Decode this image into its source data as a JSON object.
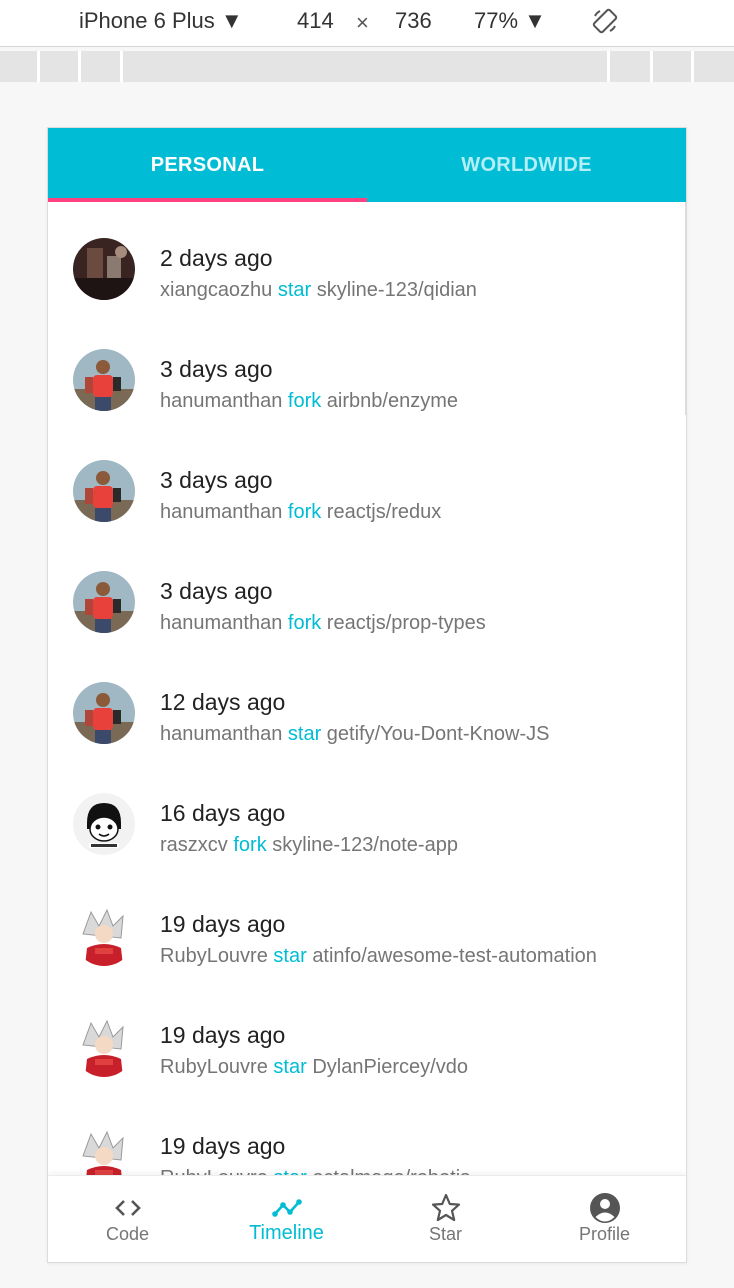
{
  "devtools": {
    "device": "iPhone 6 Plus ▼",
    "width": "414",
    "times": "×",
    "height": "736",
    "zoom": "77% ▼"
  },
  "tabs": [
    {
      "label": "PERSONAL",
      "active": true
    },
    {
      "label": "WORLDWIDE",
      "active": false
    }
  ],
  "feed": [
    {
      "time": "2 days ago",
      "user": "xiangcaozhu",
      "action": "star",
      "repo": "skyline-123/qidian",
      "avatar": "dark-photo"
    },
    {
      "time": "3 days ago",
      "user": "hanumanthan",
      "action": "fork",
      "repo": "airbnb/enzyme",
      "avatar": "red-shirt-man"
    },
    {
      "time": "3 days ago",
      "user": "hanumanthan",
      "action": "fork",
      "repo": "reactjs/redux",
      "avatar": "red-shirt-man"
    },
    {
      "time": "3 days ago",
      "user": "hanumanthan",
      "action": "fork",
      "repo": "reactjs/prop-types",
      "avatar": "red-shirt-man"
    },
    {
      "time": "12 days ago",
      "user": "hanumanthan",
      "action": "star",
      "repo": "getify/You-Dont-Know-JS",
      "avatar": "red-shirt-man"
    },
    {
      "time": "16 days ago",
      "user": "raszxcv",
      "action": "fork",
      "repo": "skyline-123/note-app",
      "avatar": "cartoon-face"
    },
    {
      "time": "19 days ago",
      "user": "RubyLouvre",
      "action": "star",
      "repo": "atinfo/awesome-test-automation",
      "avatar": "anime-character"
    },
    {
      "time": "19 days ago",
      "user": "RubyLouvre",
      "action": "star",
      "repo": "DylanPiercey/vdo",
      "avatar": "anime-character"
    },
    {
      "time": "19 days ago",
      "user": "RubyLouvre",
      "action": "star",
      "repo": "octalmage/robotjs",
      "avatar": "anime-character"
    }
  ],
  "bottom_nav": [
    {
      "label": "Code",
      "icon": "code-icon",
      "active": false
    },
    {
      "label": "Timeline",
      "icon": "timeline-icon",
      "active": true
    },
    {
      "label": "Star",
      "icon": "star-icon",
      "active": false
    },
    {
      "label": "Profile",
      "icon": "account-circle-icon",
      "active": false
    }
  ],
  "colors": {
    "primary": "#00bcd4",
    "accent": "#ff4081",
    "muted_tab": "#b4eef6",
    "text_primary": "#222222",
    "text_secondary": "#757575"
  }
}
